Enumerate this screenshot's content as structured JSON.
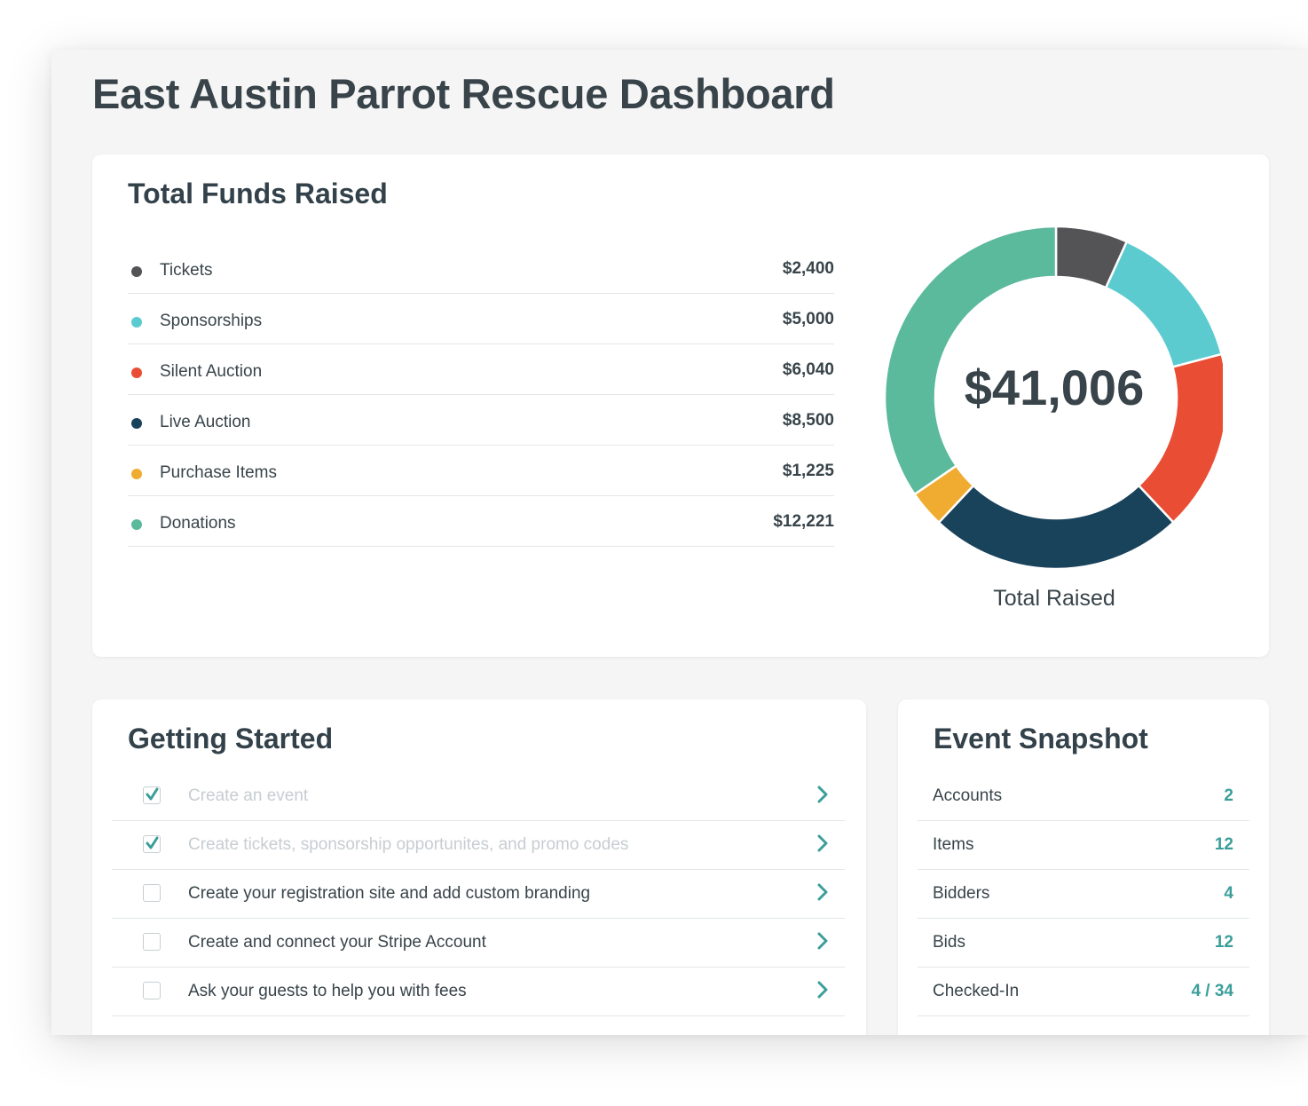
{
  "page": {
    "title": "East Austin Parrot Rescue Dashboard"
  },
  "funds": {
    "title": "Total Funds Raised",
    "items": [
      {
        "label": "Tickets",
        "value": "$2,400",
        "amount": 2400,
        "color": "#545356"
      },
      {
        "label": "Sponsorships",
        "value": "$5,000",
        "amount": 5000,
        "color": "#5ccbd0"
      },
      {
        "label": "Silent Auction",
        "value": "$6,040",
        "amount": 6040,
        "color": "#e94e35"
      },
      {
        "label": "Live Auction",
        "value": "$8,500",
        "amount": 8500,
        "color": "#19425b"
      },
      {
        "label": "Purchase Items",
        "value": "$1,225",
        "amount": 1225,
        "color": "#f0ac30"
      },
      {
        "label": "Donations",
        "value": "$12,221",
        "amount": 12221,
        "color": "#5bb99c"
      }
    ],
    "total": "$41,006",
    "caption": "Total Raised"
  },
  "chart_data": {
    "type": "pie",
    "categories": [
      "Tickets",
      "Sponsorships",
      "Silent Auction",
      "Live Auction",
      "Purchase Items",
      "Donations"
    ],
    "values": [
      2400,
      5000,
      6040,
      8500,
      1225,
      12221
    ],
    "colors": [
      "#545356",
      "#5ccbd0",
      "#e94e35",
      "#19425b",
      "#f0ac30",
      "#5bb99c"
    ],
    "center_label": "$41,006",
    "xlabel": "Total Raised"
  },
  "getting_started": {
    "title": "Getting Started",
    "tasks": [
      {
        "label": "Create an event",
        "done": true
      },
      {
        "label": "Create tickets, sponsorship opportunites, and promo codes",
        "done": true
      },
      {
        "label": "Create your registration site and add custom branding",
        "done": false
      },
      {
        "label": "Create and connect your Stripe Account",
        "done": false
      },
      {
        "label": "Ask your guests to help you with fees",
        "done": false
      }
    ]
  },
  "snapshot": {
    "title": "Event Snapshot",
    "stats": [
      {
        "label": "Accounts",
        "value": "2"
      },
      {
        "label": "Items",
        "value": "12"
      },
      {
        "label": "Bidders",
        "value": "4"
      },
      {
        "label": "Bids",
        "value": "12"
      },
      {
        "label": "Checked-In",
        "value": "4 / 34"
      }
    ]
  },
  "theme": {
    "accent": "#3a9e9a",
    "check": "#3a9e9a",
    "chevron": "#3a9e9a"
  }
}
